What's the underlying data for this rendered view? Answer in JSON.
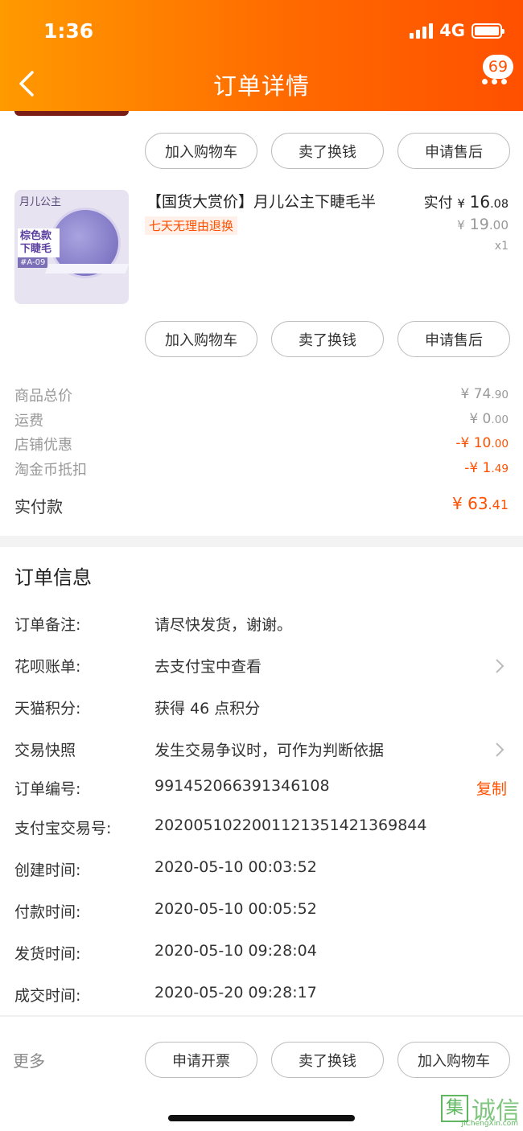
{
  "status_bar": {
    "time": "1:36",
    "network": "4G"
  },
  "nav": {
    "title": "订单详情",
    "badge_count": "69"
  },
  "top_buttons": [
    "加入购物车",
    "卖了换钱",
    "申请售后"
  ],
  "product": {
    "image_brand": "月儿公主",
    "image_label": "棕色款 下睫毛",
    "image_code": "#A-09",
    "title": "【国货大赏价】月儿公主下睫毛半",
    "tag": "七天无理由退换",
    "paid_label": "实付",
    "paid_symbol": "¥",
    "paid_int": "16",
    "paid_dec": ".08",
    "orig_symbol": "¥",
    "orig_int": "19",
    "orig_dec": ".00",
    "qty": "x1"
  },
  "product_buttons": [
    "加入购物车",
    "卖了换钱",
    "申请售后"
  ],
  "summary": {
    "rows": [
      {
        "label": "商品总价",
        "prefix": "¥ ",
        "int": "74",
        "dec": ".90"
      },
      {
        "label": "运费",
        "prefix": "¥ ",
        "int": "0",
        "dec": ".00"
      },
      {
        "label": "店铺优惠",
        "prefix": "-¥ ",
        "int": "10",
        "dec": ".00"
      },
      {
        "label": "淘金币抵扣",
        "prefix": "-¥ ",
        "int": "1",
        "dec": ".49"
      }
    ],
    "pay_label": "实付款",
    "pay_prefix": "¥ ",
    "pay_int": "63",
    "pay_dec": ".41"
  },
  "order_info": {
    "title": "订单信息",
    "remark": {
      "k": "订单备注:",
      "v": "请尽快发货，谢谢。"
    },
    "huabei": {
      "k": "花呗账单:",
      "v": "去支付宝中查看"
    },
    "points": {
      "k": "天猫积分:",
      "v": "获得 46 点积分"
    },
    "snapshot": {
      "k": "交易快照",
      "v": "发生交易争议时，可作为判断依据"
    },
    "order_no": {
      "k": "订单编号:",
      "v": "991452066391346108",
      "action": "复制"
    },
    "alipay_no": {
      "k": "支付宝交易号:",
      "v": "2020051022001121351421369844"
    },
    "created": {
      "k": "创建时间:",
      "v": "2020-05-10 00:03:52"
    },
    "paid": {
      "k": "付款时间:",
      "v": "2020-05-10 00:05:52"
    },
    "shipped": {
      "k": "发货时间:",
      "v": "2020-05-10 09:28:04"
    },
    "completed": {
      "k": "成交时间:",
      "v": "2020-05-20 09:28:17"
    }
  },
  "footer": {
    "more": "更多",
    "buttons": [
      "申请开票",
      "卖了换钱",
      "加入购物车"
    ]
  },
  "watermark": {
    "logo": "集",
    "text": "诚信",
    "sub": "JiChengXin.com"
  },
  "colors": {
    "accent": "#ff5000",
    "header_start": "#ff9a00",
    "header_end": "#ff5000"
  }
}
